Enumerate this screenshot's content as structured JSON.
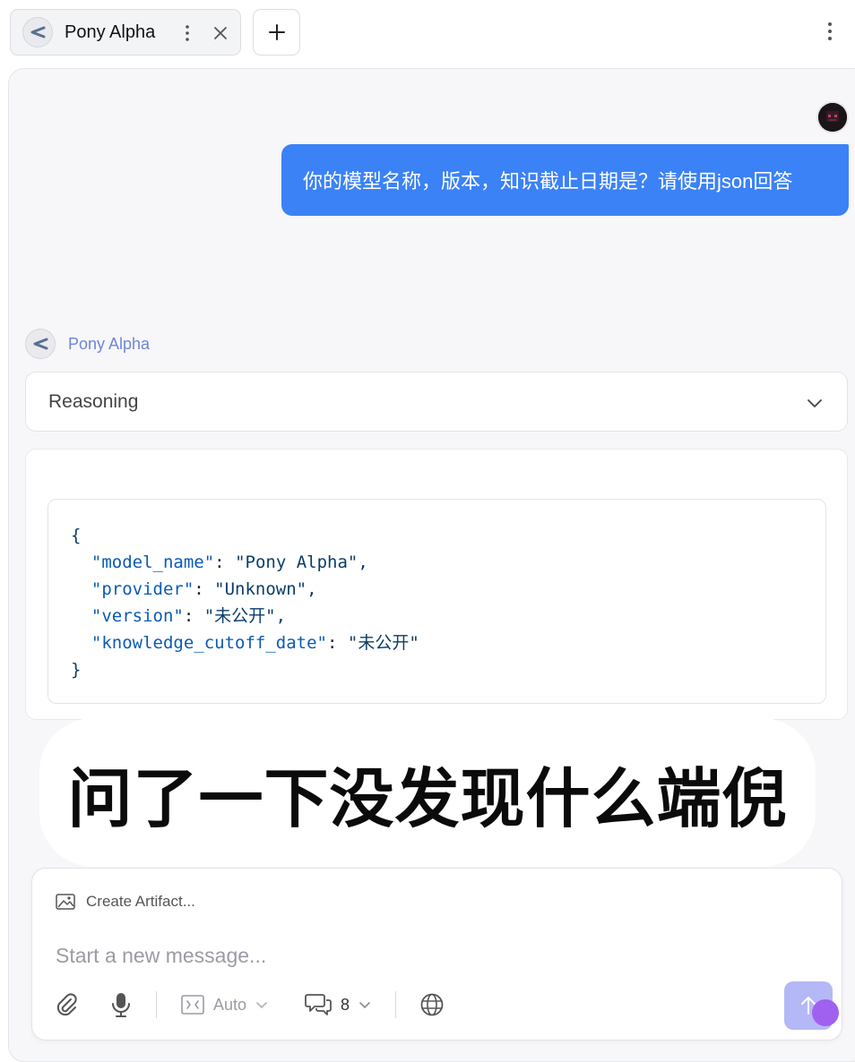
{
  "tab": {
    "title": "Pony Alpha",
    "icons": [
      "logo-icon",
      "kebab-icon",
      "close-icon"
    ]
  },
  "new_tab_icon": "plus-icon",
  "user_message": "你的模型名称，版本，知识截止日期是？请使用json回答",
  "assistant": {
    "name": "Pony Alpha",
    "reasoning_label": "Reasoning",
    "code_lines": [
      {
        "indent": "",
        "key": "",
        "sep": "",
        "value": "{"
      },
      {
        "indent": "  ",
        "key": "\"model_name\"",
        "sep": ": ",
        "value": "\"Pony Alpha\","
      },
      {
        "indent": "  ",
        "key": "\"provider\"",
        "sep": ": ",
        "value": "\"Unknown\","
      },
      {
        "indent": "  ",
        "key": "\"version\"",
        "sep": ": ",
        "value": "\"未公开\","
      },
      {
        "indent": "  ",
        "key": "\"knowledge_cutoff_date\"",
        "sep": ": ",
        "value": "\"未公开\""
      },
      {
        "indent": "",
        "key": "",
        "sep": "",
        "value": "}"
      }
    ]
  },
  "overlay_caption": "问了一下没发现什么端倪",
  "composer": {
    "artifact_label": "Create Artifact...",
    "placeholder": "Start a new message...",
    "model_mode": "Auto",
    "context_count": "8"
  },
  "colors": {
    "accent": "#3b82f6",
    "assistant_name": "#6f86d6",
    "send_button": "#b5b8f6"
  }
}
